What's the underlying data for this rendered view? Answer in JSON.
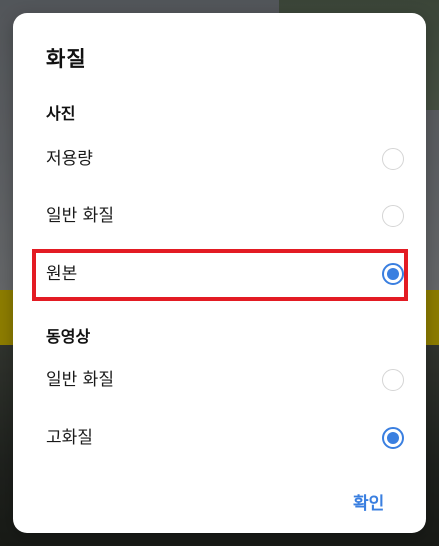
{
  "dialog": {
    "title": "화질",
    "confirm_label": "확인",
    "accent_color": "#3a7fe0",
    "highlight_color": "#e31b23"
  },
  "sections": [
    {
      "label": "사진",
      "options": [
        {
          "label": "저용량",
          "selected": false
        },
        {
          "label": "일반 화질",
          "selected": false
        },
        {
          "label": "원본",
          "selected": true
        }
      ]
    },
    {
      "label": "동영상",
      "options": [
        {
          "label": "일반 화질",
          "selected": false
        },
        {
          "label": "고화질",
          "selected": true
        }
      ]
    }
  ]
}
